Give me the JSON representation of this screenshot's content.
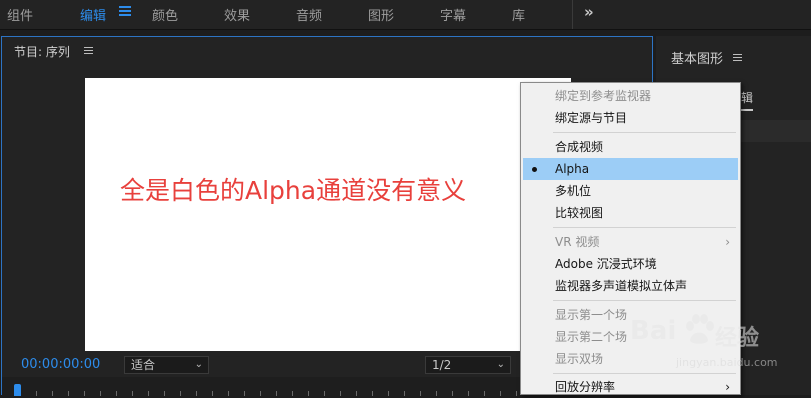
{
  "workspace_tabs": [
    {
      "label": "组件",
      "active": false
    },
    {
      "label": "编辑",
      "active": true
    },
    {
      "label": "颜色",
      "active": false
    },
    {
      "label": "效果",
      "active": false
    },
    {
      "label": "音频",
      "active": false
    },
    {
      "label": "图形",
      "active": false
    },
    {
      "label": "字幕",
      "active": false
    },
    {
      "label": "库",
      "active": false
    }
  ],
  "overflow_label": "»",
  "program_monitor": {
    "title": "节目: 序列",
    "annotation": "全是白色的Alpha通道没有意义",
    "timecode": "00:00:00:00",
    "zoom_select": "适合",
    "resolution_select": "1/2"
  },
  "right_panel": {
    "title": "基本图形",
    "tab_fragment": "辑"
  },
  "context_menu": {
    "items": [
      {
        "label": "绑定到参考监视器",
        "disabled": true
      },
      {
        "label": "绑定源与节目",
        "disabled": false
      },
      {
        "separator": true
      },
      {
        "label": "合成视频",
        "disabled": false
      },
      {
        "label": "Alpha",
        "disabled": false,
        "selected": true,
        "checked": true
      },
      {
        "label": "多机位",
        "disabled": false
      },
      {
        "label": "比较视图",
        "disabled": false
      },
      {
        "separator": true
      },
      {
        "label": "VR 视频",
        "disabled": true,
        "submenu": true
      },
      {
        "label": "Adobe 沉浸式环境",
        "disabled": false
      },
      {
        "label": "监视器多声道模拟立体声",
        "disabled": false
      },
      {
        "separator": true
      },
      {
        "label": "显示第一个场",
        "disabled": true
      },
      {
        "label": "显示第二个场",
        "disabled": true
      },
      {
        "label": "显示双场",
        "disabled": true
      },
      {
        "separator": true
      },
      {
        "label": "回放分辨率",
        "disabled": false,
        "submenu": true
      }
    ]
  },
  "watermark": {
    "brand_left": "Bai",
    "brand_right": "经验",
    "url": "jingyan.baidu.com"
  },
  "colors": {
    "accent": "#2d8ceb",
    "annotation": "#e8403c",
    "menu_highlight": "#9ccdf6"
  }
}
